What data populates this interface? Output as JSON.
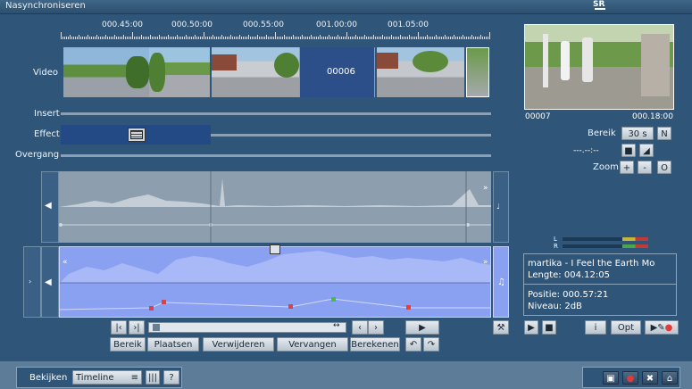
{
  "app": {
    "title": "Nasynchroniseren",
    "badge": "SR"
  },
  "ruler": {
    "timecodes": [
      "000.45:00",
      "000.50:00",
      "000.55:00",
      "001.00:00",
      "001.05:00"
    ]
  },
  "tracks": {
    "video_label": "Video",
    "insert_label": "Insert",
    "effect_label": "Effect",
    "transition_label": "Overgang",
    "scene_number": "00006"
  },
  "preview": {
    "start": "00007",
    "end": "000.18:00"
  },
  "range": {
    "label": "Bereik",
    "value": "30 s",
    "n_button": "N"
  },
  "position_placeholder": "---.--:--",
  "zoom": {
    "label": "Zoom",
    "plus": "+",
    "minus": "-",
    "o": "O"
  },
  "levels": {
    "l": "L",
    "r": "R"
  },
  "audio_info": {
    "title": "martika - I Feel the Earth Mo",
    "length": "Lengte: 004.12:05",
    "position": "Positie: 000.57:21",
    "level": "Niveau: 2dB"
  },
  "toolbar": {
    "range": "Bereik",
    "place": "Plaatsen",
    "remove": "Verwijderen",
    "replace": "Vervangen",
    "calculate": "Berekenen"
  },
  "side_buttons": {
    "info": "i",
    "opt": "Opt"
  },
  "bottom": {
    "view_label": "Bekijken",
    "view_value": "Timeline",
    "grid": "|||",
    "help": "?"
  },
  "colors": {
    "accent_blue": "#2c4f8a",
    "audio_active": "#8aa0f0",
    "record_red": "#e03a3a"
  }
}
